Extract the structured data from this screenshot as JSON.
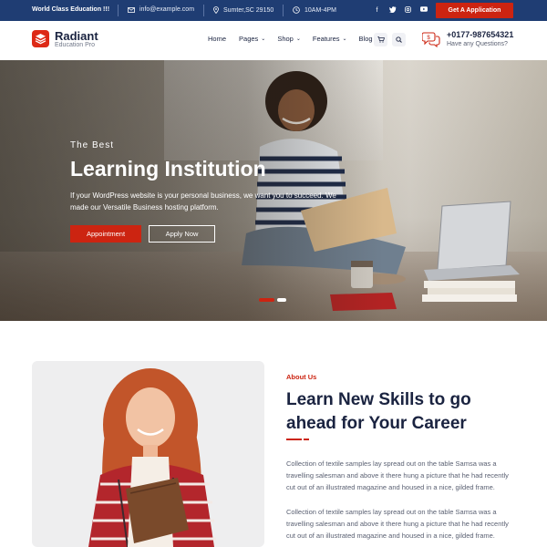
{
  "topbar": {
    "tagline": "World Class Education !!!",
    "email": "info@example.com",
    "location": "Sumter,SC 29150",
    "hours": "10AM-4PM",
    "social": [
      "facebook-icon",
      "twitter-icon",
      "instagram-icon",
      "youtube-icon"
    ],
    "apply_label": "Get A Application"
  },
  "header": {
    "brand": "Radiant",
    "brand_sub": "Education Pro",
    "nav": [
      {
        "label": "Home",
        "dropdown": false
      },
      {
        "label": "Pages",
        "dropdown": true
      },
      {
        "label": "Shop",
        "dropdown": true
      },
      {
        "label": "Features",
        "dropdown": true
      },
      {
        "label": "Blog",
        "dropdown": false
      }
    ],
    "phone": "+0177-987654321",
    "phone_caption": "Have any Questions?"
  },
  "hero": {
    "kicker": "The Best",
    "title": "Learning Institution",
    "description": "If your WordPress website is your personal business, we want you to succeed. We made our Versatile Business hosting platform.",
    "primary_button": "Appointment",
    "secondary_button": "Apply Now",
    "slide_count": 2,
    "active_slide": 1
  },
  "about": {
    "kicker": "About Us",
    "title": "Learn New Skills to go ahead for Your Career",
    "paragraphs": [
      "Collection of textile samples lay spread out on the table Samsa was a travelling salesman and above it there hung a picture that he had recently cut out of an illustrated magazine and housed in a nice, gilded frame.",
      "Collection of textile samples lay spread out on the table Samsa was a travelling salesman and above it there hung a picture that he had recently cut out of an illustrated magazine and housed in a nice, gilded frame."
    ]
  },
  "colors": {
    "topbar": "#1f3d73",
    "accent": "#cc2411",
    "heading": "#1a2340"
  }
}
